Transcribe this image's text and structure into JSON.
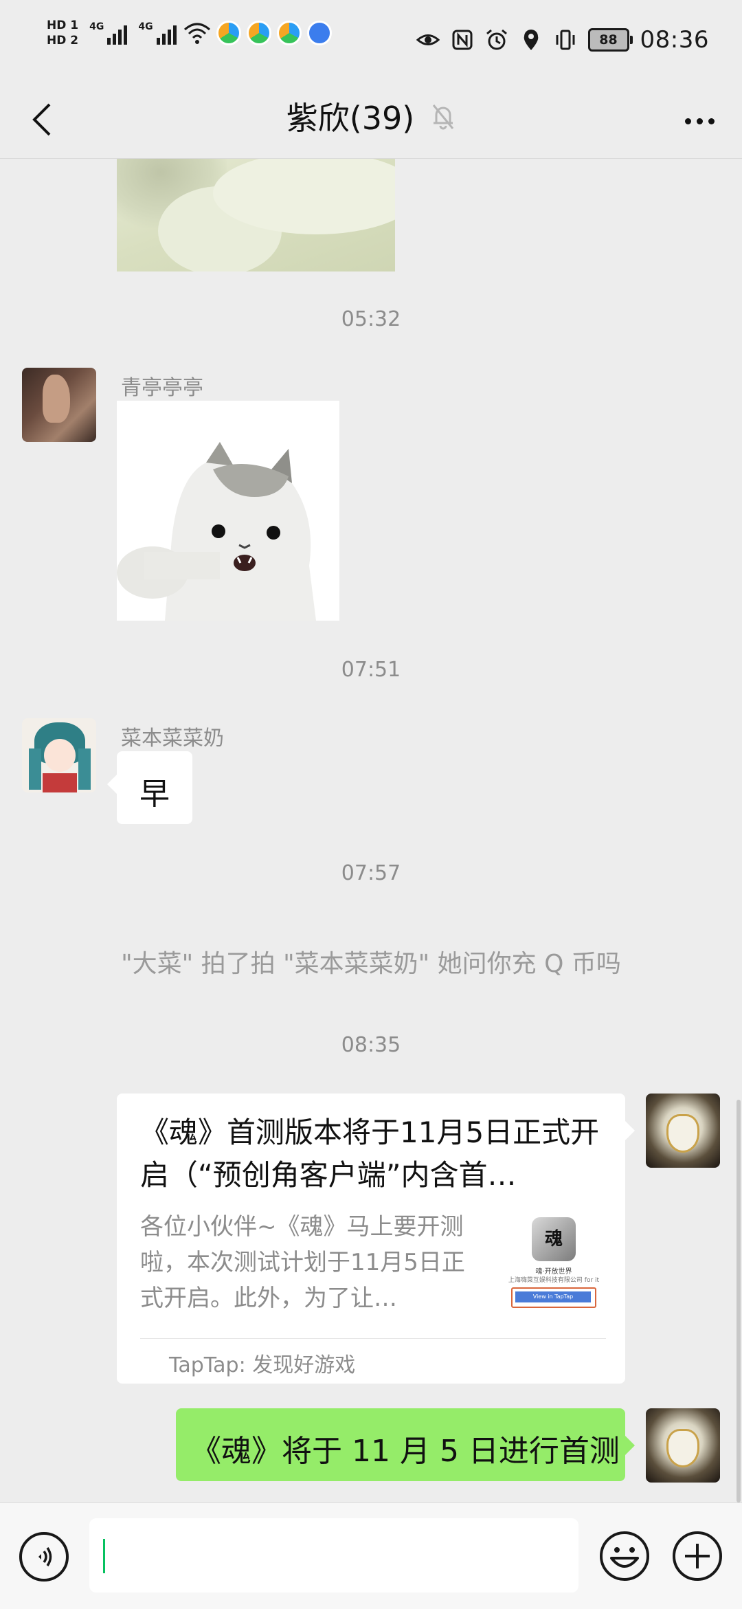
{
  "status_bar": {
    "hd1": "HD 1",
    "hd2": "HD 2",
    "net1": "4G",
    "net2": "4G",
    "battery": "88",
    "time": "08:36",
    "icons": [
      "eye-icon",
      "nfc-icon",
      "alarm-icon",
      "location-icon",
      "vibrate-icon"
    ],
    "app_colors": [
      "#2a9df4",
      "#36c35a",
      "#f5a623",
      "#3b7ded"
    ]
  },
  "navbar": {
    "title": "紫欣(39)",
    "mute_icon": "bell-off-icon"
  },
  "messages": {
    "ts1": "05:32",
    "m2_sender": "青亭亭亭",
    "ts2": "07:51",
    "m3_sender": "菜本菜菜奶",
    "m3_text": "早",
    "ts3": "07:57",
    "sys1": "\"大菜\" 拍了拍 \"菜本菜菜奶\" 她问你充 Q 币吗",
    "ts4": "08:35",
    "card_title": "《魂》首测版本将于11月5日正式开启（“预创角客户端”内含首…",
    "card_desc": "各位小伙伴~《魂》马上要开测啦，本次测试计划于11月5日正式开启。此外，为了让…",
    "card_thumb_title": "魂·开放世界",
    "card_thumb_company": "上海嗨菜互娱科技有限公司 for it",
    "card_thumb_button": "View in TapTap",
    "card_source": "TapTap: 发现好游戏",
    "m5_text": "《魂》将于 11 月 5 日进行首测"
  },
  "colors": {
    "accent_green": "#95ec69",
    "cursor_green": "#07c160",
    "background": "#ededed"
  }
}
